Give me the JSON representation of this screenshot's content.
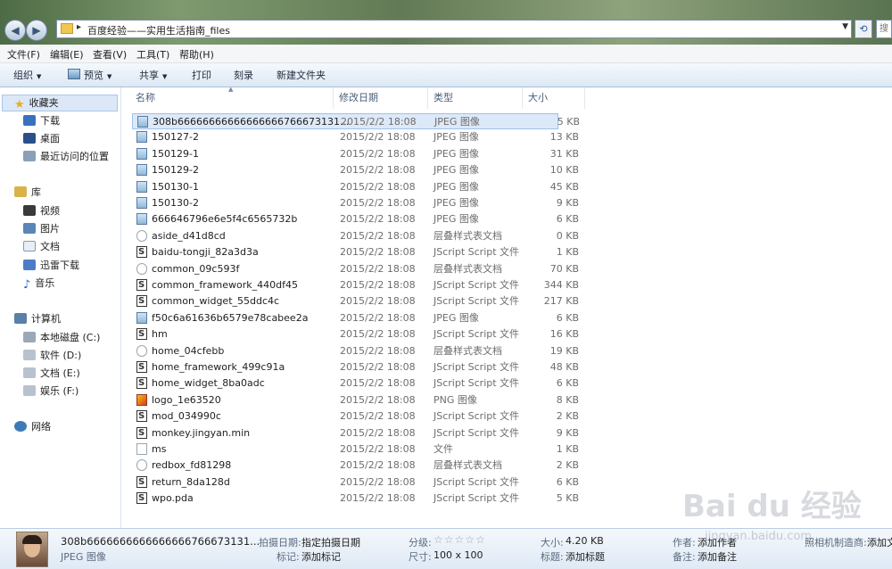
{
  "address": {
    "path": "百度经验——实用生活指南_files",
    "search_placeholder": "搜"
  },
  "menu": [
    "文件(F)",
    "编辑(E)",
    "查看(V)",
    "工具(T)",
    "帮助(H)"
  ],
  "toolbar": {
    "organize": "组织",
    "preview": "预览",
    "share": "共享",
    "print": "打印",
    "burn": "刻录",
    "new_folder": "新建文件夹"
  },
  "nav": {
    "favorites": "收藏夹",
    "fav_items": [
      "下载",
      "桌面",
      "最近访问的位置"
    ],
    "library": "库",
    "lib_items": [
      "视频",
      "图片",
      "文档",
      "迅雷下载",
      "音乐"
    ],
    "computer": "计算机",
    "drives": [
      "本地磁盘 (C:)",
      "软件 (D:)",
      "文档 (E:)",
      "娱乐 (F:)"
    ],
    "network": "网络"
  },
  "columns": {
    "name": "名称",
    "date": "修改日期",
    "type": "类型",
    "size": "大小"
  },
  "files": [
    {
      "icon": "jpeg",
      "name": "308b66666666666666666766673131...",
      "date": "2015/2/2 18:08",
      "type": "JPEG 图像",
      "size": "5 KB"
    },
    {
      "icon": "jpeg",
      "name": "150127-2",
      "date": "2015/2/2 18:08",
      "type": "JPEG 图像",
      "size": "13 KB"
    },
    {
      "icon": "jpeg",
      "name": "150129-1",
      "date": "2015/2/2 18:08",
      "type": "JPEG 图像",
      "size": "31 KB"
    },
    {
      "icon": "jpeg",
      "name": "150129-2",
      "date": "2015/2/2 18:08",
      "type": "JPEG 图像",
      "size": "10 KB"
    },
    {
      "icon": "jpeg",
      "name": "150130-1",
      "date": "2015/2/2 18:08",
      "type": "JPEG 图像",
      "size": "45 KB"
    },
    {
      "icon": "jpeg",
      "name": "150130-2",
      "date": "2015/2/2 18:08",
      "type": "JPEG 图像",
      "size": "9 KB"
    },
    {
      "icon": "jpeg",
      "name": "666646796e6e5f4c6565732b",
      "date": "2015/2/2 18:08",
      "type": "JPEG 图像",
      "size": "6 KB"
    },
    {
      "icon": "css",
      "name": "aside_d41d8cd",
      "date": "2015/2/2 18:08",
      "type": "层叠样式表文档",
      "size": "0 KB"
    },
    {
      "icon": "js",
      "name": "baidu-tongji_82a3d3a",
      "date": "2015/2/2 18:08",
      "type": "JScript Script 文件",
      "size": "1 KB"
    },
    {
      "icon": "css",
      "name": "common_09c593f",
      "date": "2015/2/2 18:08",
      "type": "层叠样式表文档",
      "size": "70 KB"
    },
    {
      "icon": "js",
      "name": "common_framework_440df45",
      "date": "2015/2/2 18:08",
      "type": "JScript Script 文件",
      "size": "344 KB"
    },
    {
      "icon": "js",
      "name": "common_widget_55ddc4c",
      "date": "2015/2/2 18:08",
      "type": "JScript Script 文件",
      "size": "217 KB"
    },
    {
      "icon": "jpeg",
      "name": "f50c6a61636b6579e78cabee2a",
      "date": "2015/2/2 18:08",
      "type": "JPEG 图像",
      "size": "6 KB"
    },
    {
      "icon": "js",
      "name": "hm",
      "date": "2015/2/2 18:08",
      "type": "JScript Script 文件",
      "size": "16 KB"
    },
    {
      "icon": "css",
      "name": "home_04cfebb",
      "date": "2015/2/2 18:08",
      "type": "层叠样式表文档",
      "size": "19 KB"
    },
    {
      "icon": "js",
      "name": "home_framework_499c91a",
      "date": "2015/2/2 18:08",
      "type": "JScript Script 文件",
      "size": "48 KB"
    },
    {
      "icon": "js",
      "name": "home_widget_8ba0adc",
      "date": "2015/2/2 18:08",
      "type": "JScript Script 文件",
      "size": "6 KB"
    },
    {
      "icon": "png",
      "name": "logo_1e63520",
      "date": "2015/2/2 18:08",
      "type": "PNG 图像",
      "size": "8 KB"
    },
    {
      "icon": "js",
      "name": "mod_034990c",
      "date": "2015/2/2 18:08",
      "type": "JScript Script 文件",
      "size": "2 KB"
    },
    {
      "icon": "js",
      "name": "monkey.jingyan.min",
      "date": "2015/2/2 18:08",
      "type": "JScript Script 文件",
      "size": "9 KB"
    },
    {
      "icon": "file",
      "name": "ms",
      "date": "2015/2/2 18:08",
      "type": "文件",
      "size": "1 KB"
    },
    {
      "icon": "css",
      "name": "redbox_fd81298",
      "date": "2015/2/2 18:08",
      "type": "层叠样式表文档",
      "size": "2 KB"
    },
    {
      "icon": "js",
      "name": "return_8da128d",
      "date": "2015/2/2 18:08",
      "type": "JScript Script 文件",
      "size": "6 KB"
    },
    {
      "icon": "js",
      "name": "wpo.pda",
      "date": "2015/2/2 18:08",
      "type": "JScript Script 文件",
      "size": "5 KB"
    }
  ],
  "details": {
    "filename": "308b6666666666666666766673131...",
    "filetype": "JPEG 图像",
    "taken_label": "拍摄日期:",
    "taken_value": "指定拍摄日期",
    "tags_label": "标记:",
    "tags_value": "添加标记",
    "rating_label": "分级:",
    "dim_label": "尺寸:",
    "dim_value": "100 x 100",
    "size_label": "大小:",
    "size_value": "4.20 KB",
    "title_label": "标题:",
    "title_value": "添加标题",
    "author_label": "作者:",
    "author_value": "添加作者",
    "maker_label": "照相机制造商:",
    "maker_value": "添加文",
    "comment_label": "备注:",
    "comment_value": "添加备注"
  },
  "watermark": {
    "logo": "Bai du 经验",
    "url": "jingyan.baidu.com"
  }
}
